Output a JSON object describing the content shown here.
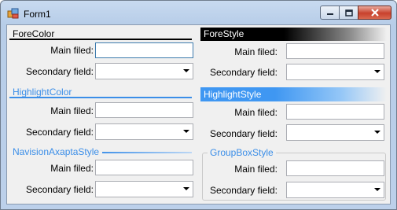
{
  "window": {
    "title": "Form1"
  },
  "caption": {
    "minimize": "minimize",
    "maximize": "maximize",
    "close": "close"
  },
  "sections": {
    "forecolor": {
      "header": "ForeColor",
      "main_label": "Main filed:",
      "secondary_label": "Secondary field:",
      "main_value": "",
      "secondary_value": ""
    },
    "forestyle": {
      "header": "ForeStyle",
      "main_label": "Main filed:",
      "secondary_label": "Secondary field:",
      "main_value": "",
      "secondary_value": ""
    },
    "highlightcolor": {
      "header": "HighlightColor",
      "main_label": "Main filed:",
      "secondary_label": "Secondary field:",
      "main_value": "",
      "secondary_value": ""
    },
    "highlightstyle": {
      "header": "HighlightStyle",
      "main_label": "Main filed:",
      "secondary_label": "Secondary field:",
      "main_value": "",
      "secondary_value": ""
    },
    "navision": {
      "header": "NavisionAxaptaStyle",
      "main_label": "Main filed:",
      "secondary_label": "Secondary field:",
      "main_value": "",
      "secondary_value": ""
    },
    "groupbox": {
      "header": "GroupBoxStyle",
      "main_label": "Main filed:",
      "secondary_label": "Secondary field:",
      "main_value": "",
      "secondary_value": ""
    }
  },
  "colors": {
    "highlight": "#3b8ee8",
    "forestyle_bg": "#000000",
    "highlightstyle_bg": "#3f97f2"
  }
}
